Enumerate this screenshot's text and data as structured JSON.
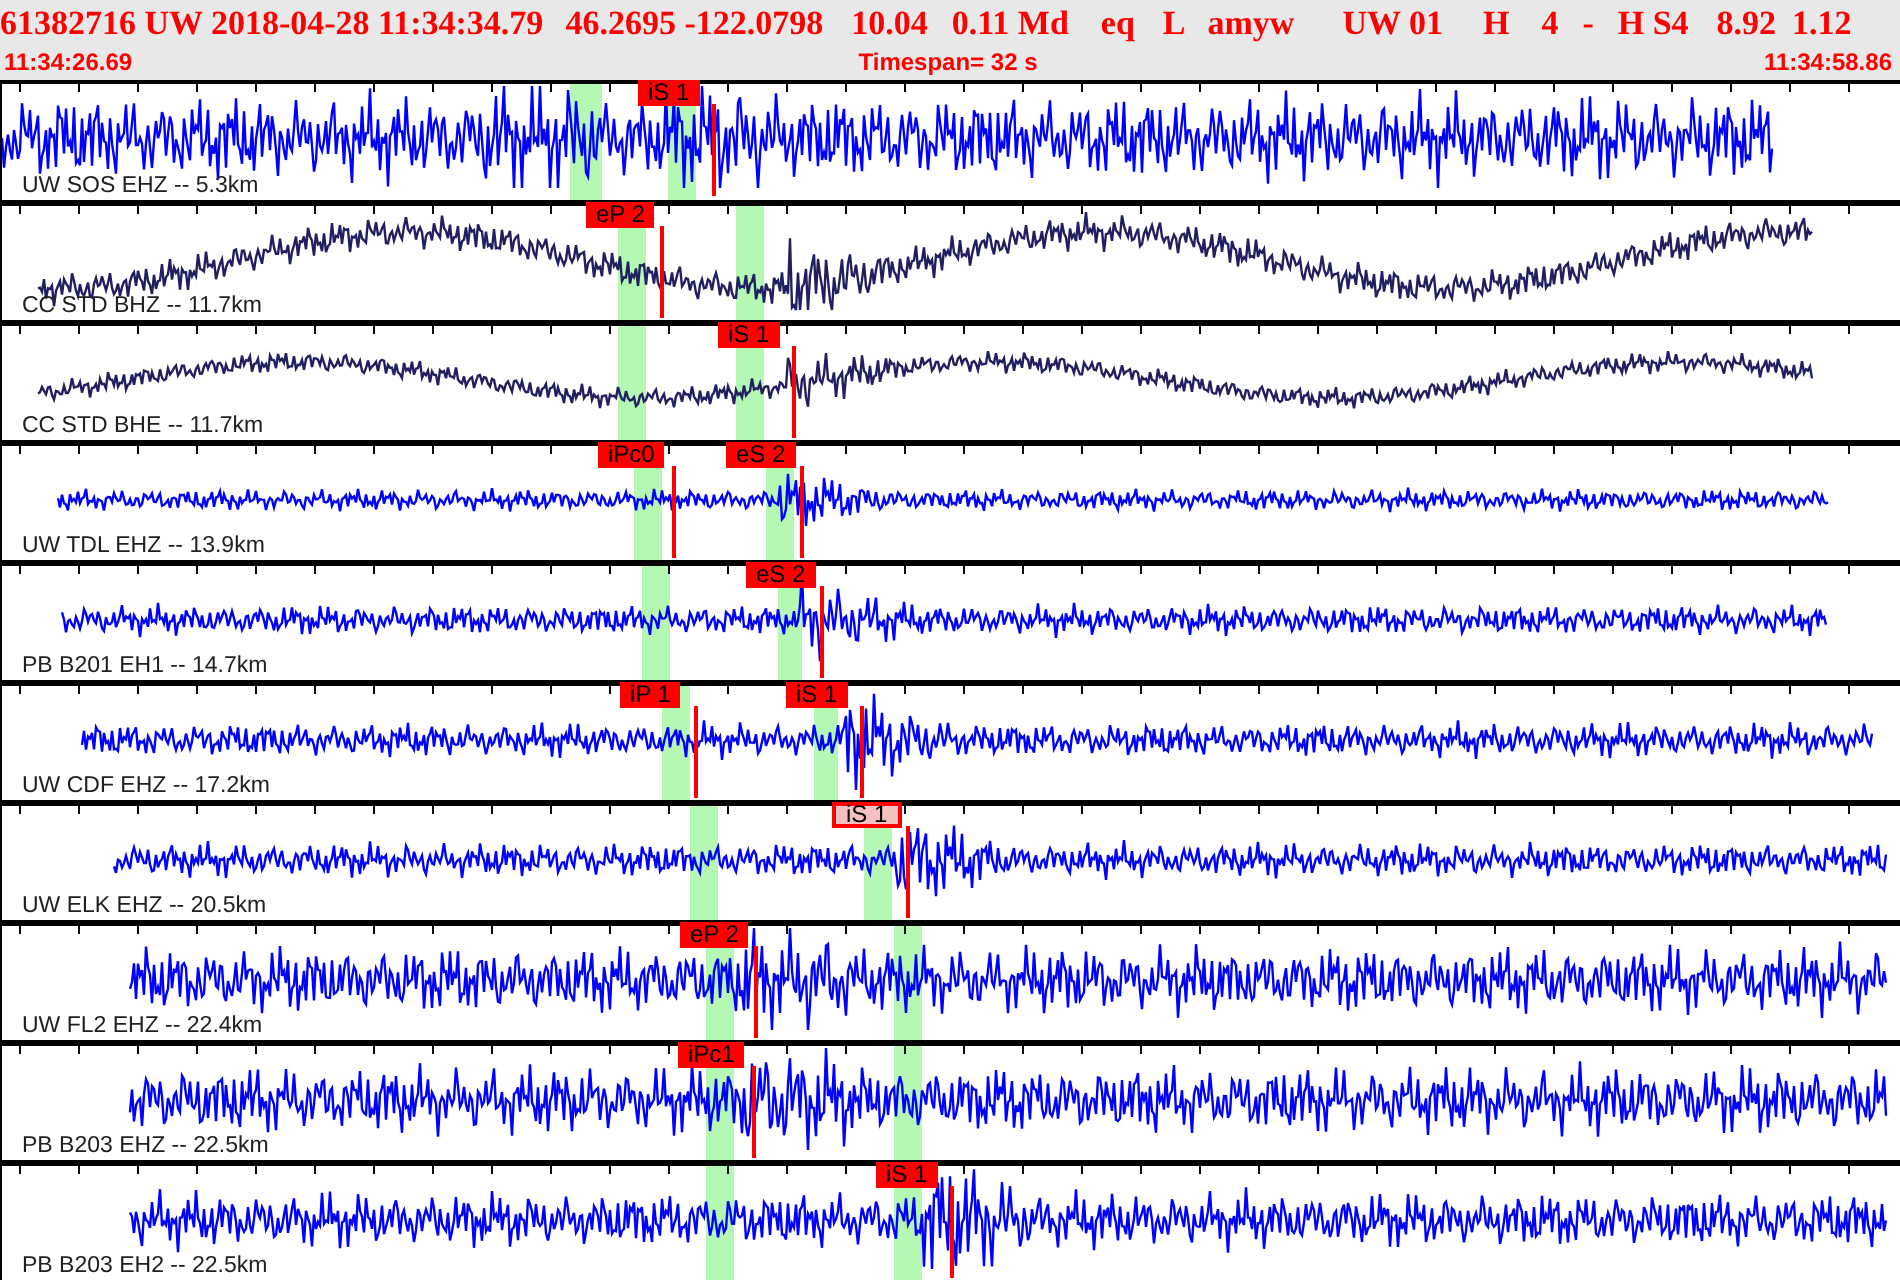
{
  "header": {
    "event_fields": [
      "61382716 UW 2018-04-28 11:34:34.79",
      "46.2695 -122.0798",
      "10.04",
      "0.11 Md",
      "eq",
      "L",
      "amyw",
      "UW 01",
      "H",
      "4",
      "-",
      "H S4",
      "8.92",
      "1.12"
    ],
    "start_time": "11:34:26.69",
    "timespan": "Timespan=  32 s",
    "end_time": "11:34:58.86"
  },
  "traces": [
    {
      "station": "UW SOS EHZ -- 5.3km",
      "color": "#0000ff",
      "picks": [
        {
          "label": "iS 1",
          "selected": false
        }
      ]
    },
    {
      "station": "CC STD BHZ -- 11.7km",
      "color": "#202060",
      "picks": [
        {
          "label": "eP 2",
          "selected": false
        }
      ]
    },
    {
      "station": "CC STD BHE -- 11.7km",
      "color": "#202060",
      "picks": [
        {
          "label": "iS 1",
          "selected": false
        }
      ]
    },
    {
      "station": "UW TDL EHZ -- 13.9km",
      "color": "#0000ff",
      "picks": [
        {
          "label": "iPc0",
          "selected": false
        },
        {
          "label": "eS 2",
          "selected": false
        }
      ]
    },
    {
      "station": "PB B201 EH1 -- 14.7km",
      "color": "#0000ff",
      "picks": [
        {
          "label": "eS 2",
          "selected": false
        }
      ]
    },
    {
      "station": "UW CDF EHZ -- 17.2km",
      "color": "#0000ff",
      "picks": [
        {
          "label": "iP 1",
          "selected": false
        },
        {
          "label": "iS 1",
          "selected": false
        }
      ]
    },
    {
      "station": "UW ELK EHZ -- 20.5km",
      "color": "#0000ff",
      "picks": [
        {
          "label": "iS 1",
          "selected": true
        }
      ]
    },
    {
      "station": "UW FL2 EHZ -- 22.4km",
      "color": "#0000ff",
      "picks": [
        {
          "label": "eP 2",
          "selected": false
        }
      ]
    },
    {
      "station": "PB B203 EHZ -- 22.5km",
      "color": "#0000ff",
      "picks": [
        {
          "label": "iPc1",
          "selected": false
        }
      ]
    },
    {
      "station": "PB B203 EH2 -- 22.5km",
      "color": "#0000ff",
      "picks": [
        {
          "label": "iS 1",
          "selected": false
        }
      ]
    }
  ]
}
